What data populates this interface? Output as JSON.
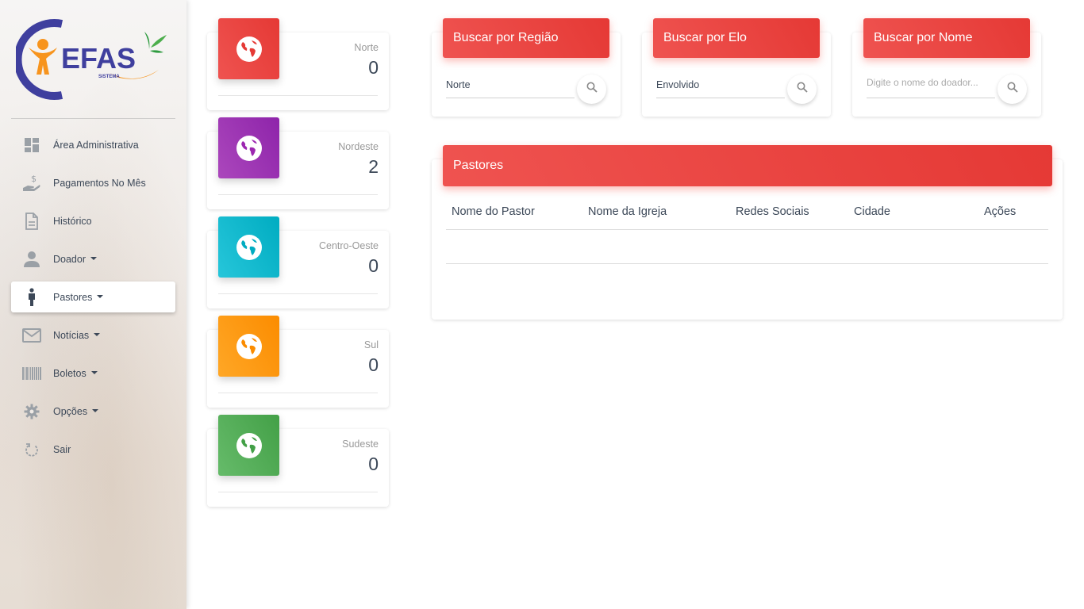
{
  "logo": {
    "text": "EFAS",
    "subtext": "SISTEMA"
  },
  "sidebar": {
    "items": [
      {
        "label": "Área Administrativa",
        "icon": "dashboard-icon",
        "dropdown": false,
        "active": false
      },
      {
        "label": "Pagamentos No Mês",
        "icon": "payment-hand-icon",
        "dropdown": false,
        "active": false
      },
      {
        "label": "Histórico",
        "icon": "document-icon",
        "dropdown": false,
        "active": false
      },
      {
        "label": "Doador",
        "icon": "person-icon",
        "dropdown": true,
        "active": false
      },
      {
        "label": "Pastores",
        "icon": "standing-person-icon",
        "dropdown": true,
        "active": true
      },
      {
        "label": "Notícias",
        "icon": "mail-icon",
        "dropdown": true,
        "active": false
      },
      {
        "label": "Boletos",
        "icon": "barcode-icon",
        "dropdown": true,
        "active": false
      },
      {
        "label": "Opções",
        "icon": "gear-icon",
        "dropdown": true,
        "active": false
      },
      {
        "label": "Sair",
        "icon": "logout-refresh-icon",
        "dropdown": false,
        "active": false
      }
    ]
  },
  "regions": [
    {
      "label": "Norte",
      "value": "0",
      "color": "#e53935"
    },
    {
      "label": "Nordeste",
      "value": "2",
      "color": "#9c27b0"
    },
    {
      "label": "Centro-Oeste",
      "value": "0",
      "color": "#00acc1"
    },
    {
      "label": "Sul",
      "value": "0",
      "color": "#fb8c00"
    },
    {
      "label": "Sudeste",
      "value": "0",
      "color": "#43a047"
    }
  ],
  "search": {
    "region": {
      "title": "Buscar por Região",
      "value": "Norte"
    },
    "elo": {
      "title": "Buscar por Elo",
      "value": "Envolvido"
    },
    "name": {
      "title": "Buscar por Nome",
      "placeholder": "Digite o nome do doador..."
    }
  },
  "pastores_table": {
    "title": "Pastores",
    "columns": [
      "Nome do Pastor",
      "Nome da Igreja",
      "Redes Sociais",
      "Cidade",
      "Ações"
    ],
    "rows": []
  },
  "colors": {
    "accent": "#e53935",
    "text": "#3c4858",
    "muted": "#999999"
  }
}
